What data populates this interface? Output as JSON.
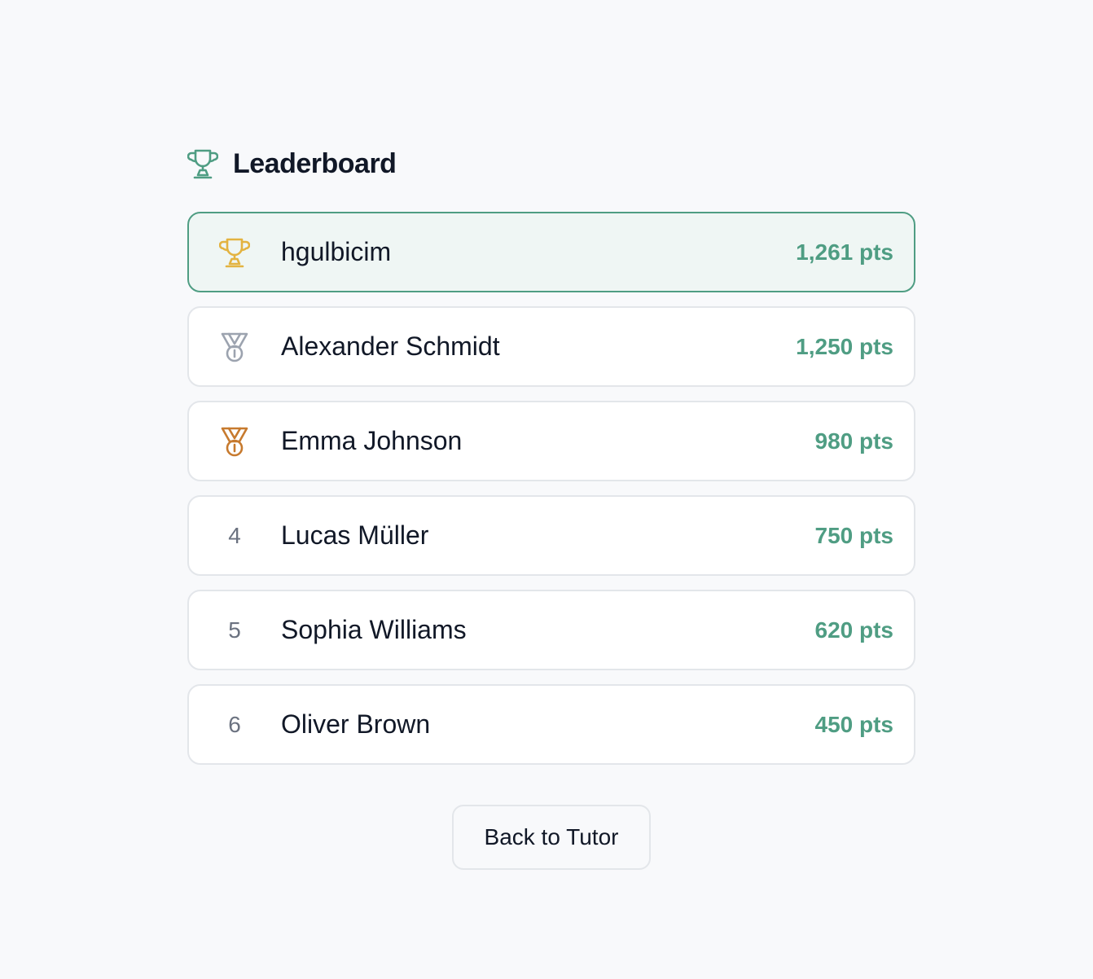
{
  "header": {
    "title": "Leaderboard",
    "icon": "trophy-icon",
    "icon_color": "#4f9d83"
  },
  "entries": [
    {
      "rank": "1",
      "icon": "gold-trophy-icon",
      "icon_color": "#e3b341",
      "name": "hgulbicim",
      "points": "1,261 pts",
      "highlighted": true
    },
    {
      "rank": "2",
      "icon": "silver-medal-icon",
      "icon_color": "#9ca3af",
      "name": "Alexander Schmidt",
      "points": "1,250 pts",
      "highlighted": false
    },
    {
      "rank": "3",
      "icon": "bronze-medal-icon",
      "icon_color": "#c77a2e",
      "name": "Emma Johnson",
      "points": "980 pts",
      "highlighted": false
    },
    {
      "rank": "4",
      "icon": null,
      "name": "Lucas Müller",
      "points": "750 pts",
      "highlighted": false
    },
    {
      "rank": "5",
      "icon": null,
      "name": "Sophia Williams",
      "points": "620 pts",
      "highlighted": false
    },
    {
      "rank": "6",
      "icon": null,
      "name": "Oliver Brown",
      "points": "450 pts",
      "highlighted": false
    }
  ],
  "actions": {
    "back_label": "Back to Tutor"
  },
  "colors": {
    "accent": "#4f9d83",
    "highlight_bg": "#eff6f4",
    "border": "#e3e6ea",
    "background": "#f8f9fb"
  }
}
